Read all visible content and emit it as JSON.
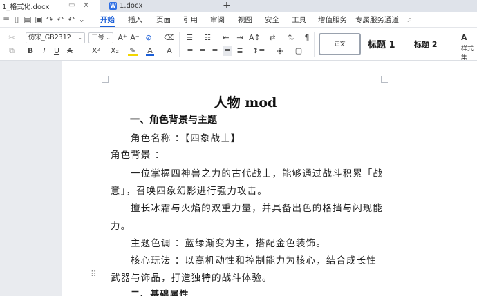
{
  "tabs": [
    {
      "label": "1_格式化.docx",
      "active": true
    },
    {
      "label": "1.docx",
      "active": false
    }
  ],
  "tab_icon_letter": "W",
  "menu": [
    "开始",
    "插入",
    "页面",
    "引用",
    "审阅",
    "视图",
    "安全",
    "工具",
    "增值服务",
    "专属服务通道"
  ],
  "ribbon": {
    "font_name": "仿宋_GB2312",
    "font_size": "三号",
    "style_normal": "正文",
    "style_h1": "标题 1",
    "style_h2": "标题 2",
    "style_panel": "样式集"
  },
  "document": {
    "title": "人物 mod",
    "heading1": "一、角色背景与主题",
    "lines": [
      "角色名称 ：【四象战士】",
      "角色背景 ：",
      "一位掌握四神兽之力的古代战士，能够通过战斗积累「战",
      "意」，召唤四象幻影进行强力攻击。",
      "擅长冰霜与火焰的双重力量，并具备出色的格挡与闪现能",
      "力。",
      "主题色调 ：蓝绿渐变为主，搭配金色装饰。",
      "核心玩法 ：以高机动性和控制能力为核心，结合成长性",
      "武器与饰品，打造独特的战斗体验。",
      "二、基础属性"
    ]
  },
  "colors": {
    "accent": "#1a5ed8",
    "page": "#ffffff",
    "canvas": "#e9ebef"
  }
}
